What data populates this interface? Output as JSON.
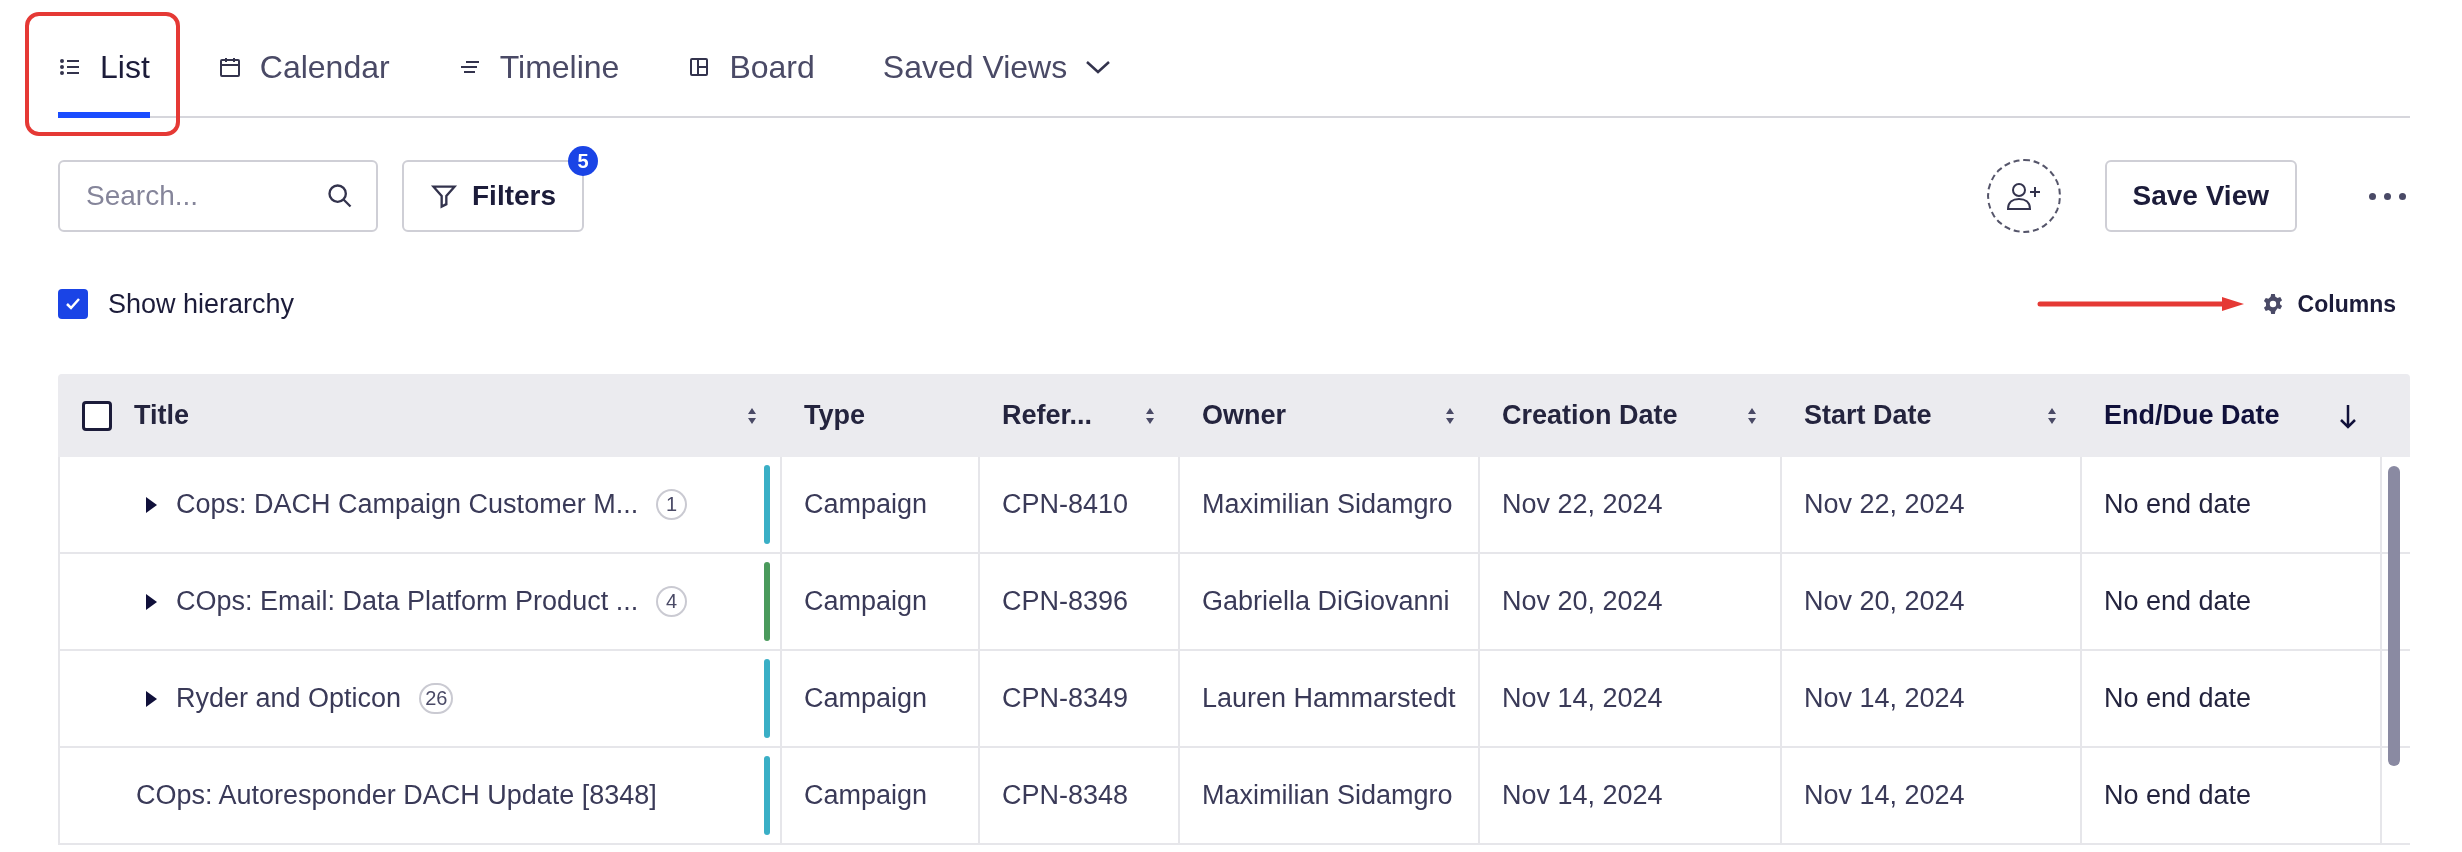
{
  "tabs": [
    {
      "kind": "list",
      "label": "List",
      "selected": true
    },
    {
      "kind": "calendar",
      "label": "Calendar",
      "selected": false
    },
    {
      "kind": "timeline",
      "label": "Timeline",
      "selected": false
    },
    {
      "kind": "board",
      "label": "Board",
      "selected": false
    },
    {
      "kind": "dropdown",
      "label": "Saved Views",
      "selected": false
    }
  ],
  "toolbar": {
    "search": {
      "placeholder": "Search..."
    },
    "filters": {
      "label": "Filters",
      "count": "5"
    },
    "save_view": "Save View"
  },
  "show_hierarchy": {
    "label": "Show hierarchy",
    "checked": true
  },
  "columns_button": "Columns",
  "table": {
    "select_all": {
      "checked": false
    },
    "columns": [
      {
        "label": "Title",
        "sortable": true,
        "sorted": false
      },
      {
        "label": "Type",
        "sortable": false,
        "sorted": false
      },
      {
        "label": "Refer...",
        "sortable": true,
        "sorted": false
      },
      {
        "label": "Owner",
        "sortable": true,
        "sorted": false
      },
      {
        "label": "Creation Date",
        "sortable": true,
        "sorted": false
      },
      {
        "label": "Start Date",
        "sortable": true,
        "sorted": false
      },
      {
        "label": "End/Due Date",
        "sortable": true,
        "sorted": true
      }
    ],
    "rows": [
      {
        "kind": "group",
        "expanded": false,
        "count": "1",
        "color": "#3aafc6",
        "cells": [
          "Cops: DACH Campaign Customer M...",
          "Campaign",
          "CPN-8410",
          "Maximilian Sidamgro",
          "Nov 22, 2024",
          "Nov 22, 2024",
          "No end date"
        ]
      },
      {
        "kind": "group",
        "expanded": false,
        "count": "4",
        "color": "#4a9a5c",
        "cells": [
          "COps: Email: Data Platform Product ...",
          "Campaign",
          "CPN-8396",
          "Gabriella DiGiovanni",
          "Nov 20, 2024",
          "Nov 20, 2024",
          "No end date"
        ]
      },
      {
        "kind": "group",
        "expanded": false,
        "count": "26",
        "color": "#3aafc6",
        "cells": [
          "Ryder and Opticon",
          "Campaign",
          "CPN-8349",
          "Lauren Hammarstedt",
          "Nov 14, 2024",
          "Nov 14, 2024",
          "No end date"
        ]
      },
      {
        "kind": "item",
        "color": "#3aafc6",
        "cells": [
          "COps: Autoresponder DACH Update [8348]",
          "Campaign",
          "CPN-8348",
          "Maximilian Sidamgro",
          "Nov 14, 2024",
          "Nov 14, 2024",
          "No end date"
        ]
      }
    ]
  }
}
